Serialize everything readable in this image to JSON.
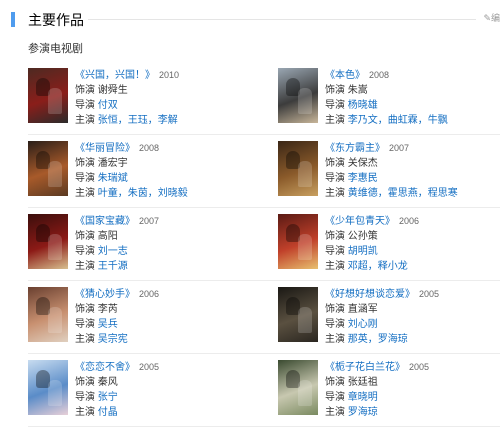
{
  "header": {
    "title": "主要作品",
    "edit_label": "✎编"
  },
  "section_title": "参演电视剧",
  "works": [
    {
      "title": "《兴国，兴国！》",
      "year": "2010",
      "role_label": "饰演",
      "role": "谢舜生",
      "director_label": "导演",
      "director": "付双",
      "cast_label": "主演",
      "cast": "张恒，王珏，李解",
      "colors": [
        "#4d2a22",
        "#8a1e1a",
        "#2b2b2b"
      ]
    },
    {
      "title": "《本色》",
      "year": "2008",
      "role_label": "饰演",
      "role": "朱嵩",
      "director_label": "导演",
      "director": "杨晓雄",
      "cast_label": "主演",
      "cast": "李乃文，曲虹霖，牛飘",
      "colors": [
        "#9aa7b3",
        "#3c3c3c",
        "#c8b69a"
      ]
    },
    {
      "title": "《华丽冒险》",
      "year": "2008",
      "role_label": "饰演",
      "role": "潘宏宇",
      "director_label": "导演",
      "director": "朱瑞斌",
      "cast_label": "主演",
      "cast": "叶童，朱茵，刘晓毅",
      "colors": [
        "#2a1e18",
        "#a85a2a",
        "#5a3a22"
      ]
    },
    {
      "title": "《东方霸主》",
      "year": "2007",
      "role_label": "饰演",
      "role": "关保杰",
      "director_label": "导演",
      "director": "李惠民",
      "cast_label": "主演",
      "cast": "黄维德，霍思燕，程思寒",
      "colors": [
        "#3a2616",
        "#8a5a2a",
        "#c8a060"
      ]
    },
    {
      "title": "《国家宝藏》",
      "year": "2007",
      "role_label": "饰演",
      "role": "高阳",
      "director_label": "导演",
      "director": "刘一志",
      "cast_label": "主演",
      "cast": "王千源",
      "colors": [
        "#3a0e0c",
        "#8c1a16",
        "#d8c090"
      ]
    },
    {
      "title": "《少年包青天》",
      "year": "2006",
      "role_label": "饰演",
      "role": "公孙策",
      "director_label": "导演",
      "director": "胡明凯",
      "cast_label": "主演",
      "cast": "邓超，释小龙",
      "colors": [
        "#5a1a14",
        "#c0402a",
        "#e8c070"
      ]
    },
    {
      "title": "《猜心妙手》",
      "year": "2006",
      "role_label": "饰演",
      "role": "李芮",
      "director_label": "导演",
      "director": "吴兵",
      "cast_label": "主演",
      "cast": "吴宗宪",
      "colors": [
        "#6a4030",
        "#c89070",
        "#e0d0c0"
      ]
    },
    {
      "title": "《好想好想谈恋爱》",
      "year": "2005",
      "role_label": "饰演",
      "role": "直涵军",
      "director_label": "导演",
      "director": "刘心刚",
      "cast_label": "主演",
      "cast": "那英，罗海琼",
      "colors": [
        "#1a1814",
        "#5a5040",
        "#2a2620"
      ]
    },
    {
      "title": "《恋恋不舍》",
      "year": "2005",
      "role_label": "饰演",
      "role": "秦风",
      "director_label": "导演",
      "director": "张宁",
      "cast_label": "主演",
      "cast": "付晶",
      "colors": [
        "#c8dcf0",
        "#5a8cc8",
        "#e8d0d8"
      ]
    },
    {
      "title": "《栀子花白兰花》",
      "year": "2005",
      "role_label": "饰演",
      "role": "张廷祖",
      "director_label": "导演",
      "director": "章晓明",
      "cast_label": "主演",
      "cast": "罗海琼",
      "colors": [
        "#3a4a30",
        "#c8c8b0",
        "#7a8a60"
      ]
    }
  ]
}
